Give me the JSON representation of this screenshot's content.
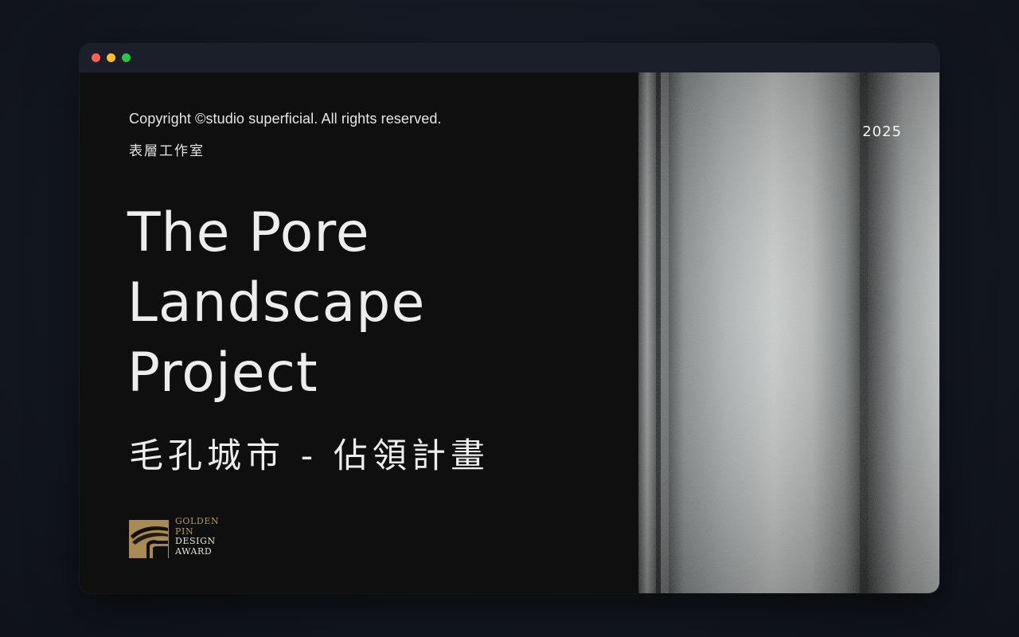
{
  "window": {
    "controls": {
      "close_color": "#ff5f57",
      "minimize_color": "#febc2e",
      "zoom_color": "#28c840"
    }
  },
  "hero": {
    "copyright": "Copyright ©studio superficial. All rights reserved.",
    "studio_name_cn": "表層工作室",
    "title_lines": [
      "The Pore",
      "Landscape",
      "Project"
    ],
    "subtitle_cn": "毛孔城市 - 佔領計畫",
    "year": "2025"
  },
  "award": {
    "lines": [
      "GOLDEN",
      "PIN",
      "DESIGN",
      "AWARD"
    ],
    "accent_color": "#b39863"
  }
}
